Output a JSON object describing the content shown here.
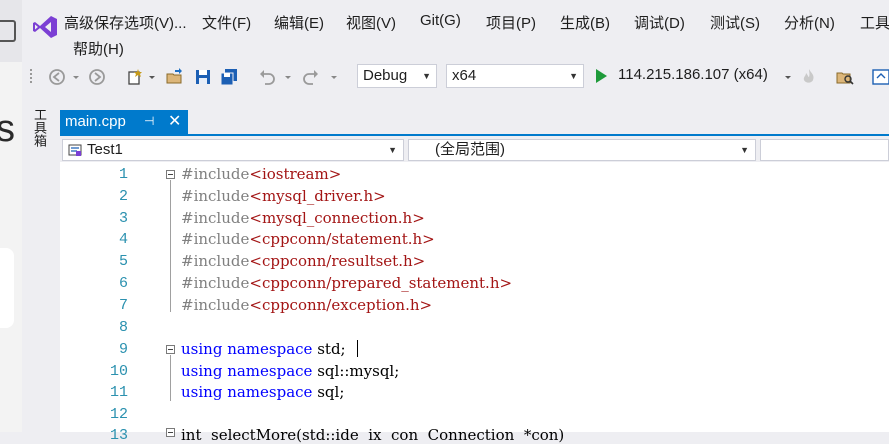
{
  "menu": {
    "items": [
      {
        "id": "adv",
        "label": "高级保存选项(V)..."
      },
      {
        "id": "file",
        "label": "文件(F)"
      },
      {
        "id": "edit",
        "label": "编辑(E)"
      },
      {
        "id": "view",
        "label": "视图(V)"
      },
      {
        "id": "git",
        "label": "Git(G)"
      },
      {
        "id": "project",
        "label": "项目(P)"
      },
      {
        "id": "build",
        "label": "生成(B)"
      },
      {
        "id": "debug",
        "label": "调试(D)"
      },
      {
        "id": "test",
        "label": "测试(S)"
      },
      {
        "id": "analyze",
        "label": "分析(N)"
      },
      {
        "id": "tools",
        "label": "工具"
      }
    ],
    "help": "帮助(H)"
  },
  "toolbar": {
    "config": "Debug",
    "platform": "x64",
    "run_target": "114.215.186.107 (x64)"
  },
  "toolbox": {
    "label": "工具箱"
  },
  "doc_tab": {
    "label": "main.cpp"
  },
  "nav": {
    "scope": "Test1",
    "global": "(全局范围)"
  },
  "left_sliver": {
    "glyph": "s"
  },
  "code": {
    "line_numbers": [
      "1",
      "2",
      "3",
      "4",
      "5",
      "6",
      "7",
      "8",
      "9",
      "10",
      "11",
      "12",
      "13"
    ],
    "lines": [
      {
        "pre": "#include",
        "str": "<iostream>"
      },
      {
        "pre": "#include",
        "str": "<mysql_driver.h>"
      },
      {
        "pre": "#include",
        "str": "<mysql_connection.h>"
      },
      {
        "pre": "#include",
        "str": "<cppconn/statement.h>"
      },
      {
        "pre": "#include",
        "str": "<cppconn/resultset.h>"
      },
      {
        "pre": "#include",
        "str": "<cppconn/prepared_statement.h>"
      },
      {
        "pre": "#include",
        "str": "<cppconn/exception.h>"
      },
      {
        "kw1": "using",
        "kw2": "namespace",
        "rest": "std;"
      },
      {
        "kw1": "using",
        "kw2": "namespace",
        "rest": "sql::mysql;"
      },
      {
        "kw1": "using",
        "kw2": "namespace",
        "rest": "sql;"
      },
      {
        "partial": "int  selectMore(std::ide  ix  con  Connection  *con)"
      }
    ]
  }
}
